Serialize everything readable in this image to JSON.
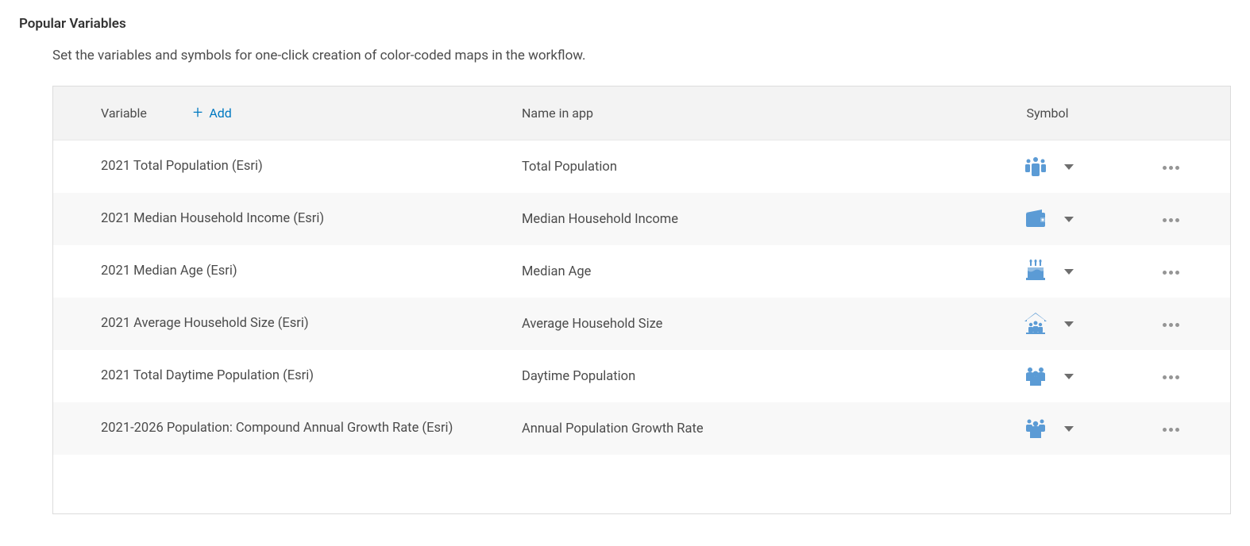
{
  "section": {
    "title": "Popular Variables",
    "description": "Set the variables and symbols for one-click creation of color-coded maps in the workflow."
  },
  "table": {
    "headers": {
      "variable": "Variable",
      "name_in_app": "Name in app",
      "symbol": "Symbol"
    },
    "add_label": "Add",
    "rows": [
      {
        "variable": "2021 Total Population (Esri)",
        "name_in_app": "Total Population",
        "icon": "people-icon"
      },
      {
        "variable": "2021 Median Household Income (Esri)",
        "name_in_app": "Median Household Income",
        "icon": "wallet-icon"
      },
      {
        "variable": "2021 Median Age (Esri)",
        "name_in_app": "Median Age",
        "icon": "cake-icon"
      },
      {
        "variable": "2021 Average Household Size (Esri)",
        "name_in_app": "Average Household Size",
        "icon": "house-icon"
      },
      {
        "variable": "2021 Total Daytime Population (Esri)",
        "name_in_app": "Daytime Population",
        "icon": "people-group-icon"
      },
      {
        "variable": "2021-2026 Population: Compound Annual Growth Rate (Esri)",
        "name_in_app": "Annual Population Growth Rate",
        "icon": "person-star-icon"
      }
    ]
  }
}
